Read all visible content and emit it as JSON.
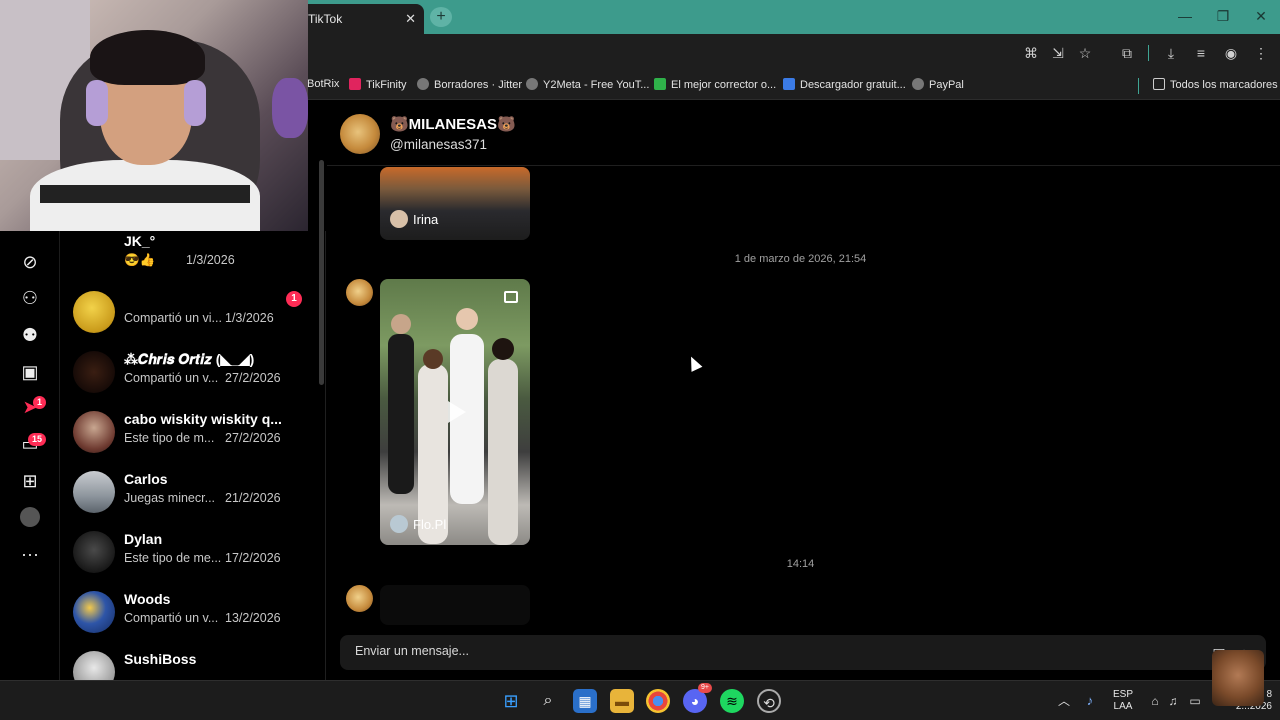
{
  "browser": {
    "tab_title": "TikTok",
    "close_glyph": "✕",
    "new_tab_glyph": "+",
    "window_controls": [
      "—",
      "❐",
      "✕"
    ],
    "bookmarks": [
      {
        "label": "BotRix",
        "color": "#3a3a3a"
      },
      {
        "label": "TikFinity",
        "color": "#e0245e"
      },
      {
        "label": "Borradores · Jitter",
        "color": "#888888"
      },
      {
        "label": "Y2Meta - Free YouT...",
        "color": "#888888"
      },
      {
        "label": "El mejor corrector o...",
        "color": "#2fb14a"
      },
      {
        "label": "Descargador gratuit...",
        "color": "#3b7be6"
      },
      {
        "label": "PayPal",
        "color": "#888888"
      }
    ],
    "all_bookmarks": "Todos los marcadores"
  },
  "rail": {
    "icons": [
      "compass-icon",
      "follow-icon",
      "friends-icon",
      "live-icon",
      "activity-icon",
      "messages-icon",
      "upload-icon",
      "profile-icon",
      "more-icon"
    ],
    "activity_badge": "1",
    "messages_badge": "15"
  },
  "conversations": [
    {
      "name": "JK_°",
      "preview": "😎👍",
      "date": "1/3/2026",
      "badge": "",
      "avatar": "#000000"
    },
    {
      "name": "",
      "preview": "Compartió un vi...",
      "date": "1/3/2026",
      "badge": "1",
      "avatar": "#e2c12f"
    },
    {
      "name": "⁂𝑪𝒉𝒓𝒊𝒔 𝑶𝒓𝒕𝒊𝒛 (◣_◢)",
      "preview": "Compartió un v...",
      "date": "27/2/2026",
      "badge": "",
      "avatar": "#1a0e0a"
    },
    {
      "name": "cabo wiskity wiskity q...",
      "preview": "Este tipo de m...",
      "date": "27/2/2026",
      "badge": "",
      "avatar": "#7a5a4c"
    },
    {
      "name": "Carlos",
      "preview": "Juegas minecr...",
      "date": "21/2/2026",
      "badge": "",
      "avatar": "#9aa3ab"
    },
    {
      "name": "Dylan",
      "preview": "Este tipo de me...",
      "date": "17/2/2026",
      "badge": "",
      "avatar": "#1a1a1a"
    },
    {
      "name": "Woods",
      "preview": "Compartió un v...",
      "date": "13/2/2026",
      "badge": "",
      "avatar": "#2e55a8"
    },
    {
      "name": "SushiBoss",
      "preview": "",
      "date": "",
      "badge": "",
      "avatar": "#d8d8d8"
    }
  ],
  "chat": {
    "name": "🐻MILANESAS🐻",
    "handle": "@milanesas371",
    "card1_user": "Irina",
    "stamp1": "1 de marzo de 2026, 21:54",
    "card2_user": "Flo.Pl",
    "stamp2": "14:14",
    "composer_placeholder": "Enviar un mensaje..."
  },
  "taskbar": {
    "lang_top": "ESP",
    "lang_bottom": "LAA",
    "clock_time": "8",
    "clock_date": "2...2026",
    "discord_badge": "9+"
  }
}
